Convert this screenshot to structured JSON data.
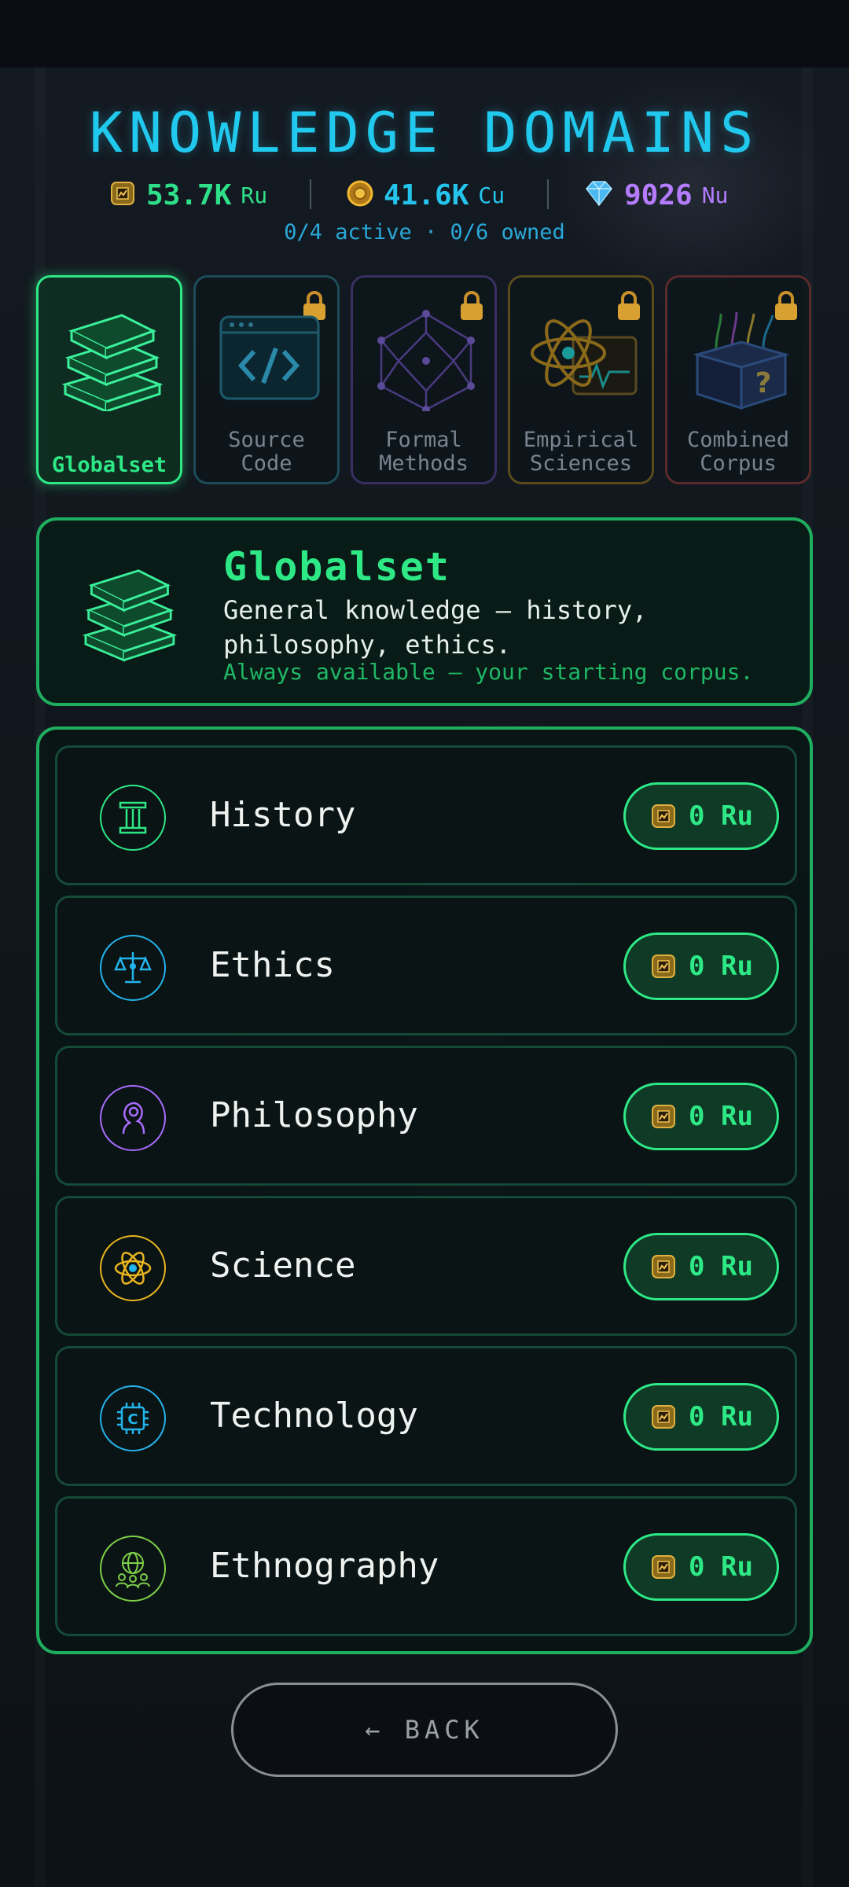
{
  "header": {
    "title": "KNOWLEDGE DOMAINS",
    "status": "0/4 active · 0/6 owned"
  },
  "currencies": [
    {
      "value": "53.7K",
      "unit": "Ru",
      "icon": "chip-coin-icon",
      "color": "#2fe08a"
    },
    {
      "value": "41.6K",
      "unit": "Cu",
      "icon": "gold-coin-icon",
      "color": "#24c4ec"
    },
    {
      "value": "9026",
      "unit": "Nu",
      "icon": "diamond-icon",
      "color": "#b57cff"
    }
  ],
  "tiles": [
    {
      "label": "Globalset",
      "locked": false,
      "selected": true
    },
    {
      "label": "Source\nCode",
      "locked": true
    },
    {
      "label": "Formal\nMethods",
      "locked": true
    },
    {
      "label": "Empirical\nSciences",
      "locked": true
    },
    {
      "label": "Combined\nCorpus",
      "locked": true
    }
  ],
  "detail": {
    "title": "Globalset",
    "description": "General knowledge — history, philosophy, ethics.",
    "note": "Always available — your starting corpus."
  },
  "domains": [
    {
      "label": "History",
      "cost": "0 Ru",
      "icon": "column-icon",
      "color": "#2ee886"
    },
    {
      "label": "Ethics",
      "cost": "0 Ru",
      "icon": "scales-icon",
      "color": "#24b4ec"
    },
    {
      "label": "Philosophy",
      "cost": "0 Ru",
      "icon": "thinker-head-icon",
      "color": "#a86cff"
    },
    {
      "label": "Science",
      "cost": "0 Ru",
      "icon": "atom-icon",
      "color": "#e8b420"
    },
    {
      "label": "Technology",
      "cost": "0 Ru",
      "icon": "cpu-chip-icon",
      "color": "#24b4ec"
    },
    {
      "label": "Ethnography",
      "cost": "0 Ru",
      "icon": "globe-people-icon",
      "color": "#7ed04a"
    }
  ],
  "back_label": "← BACK"
}
